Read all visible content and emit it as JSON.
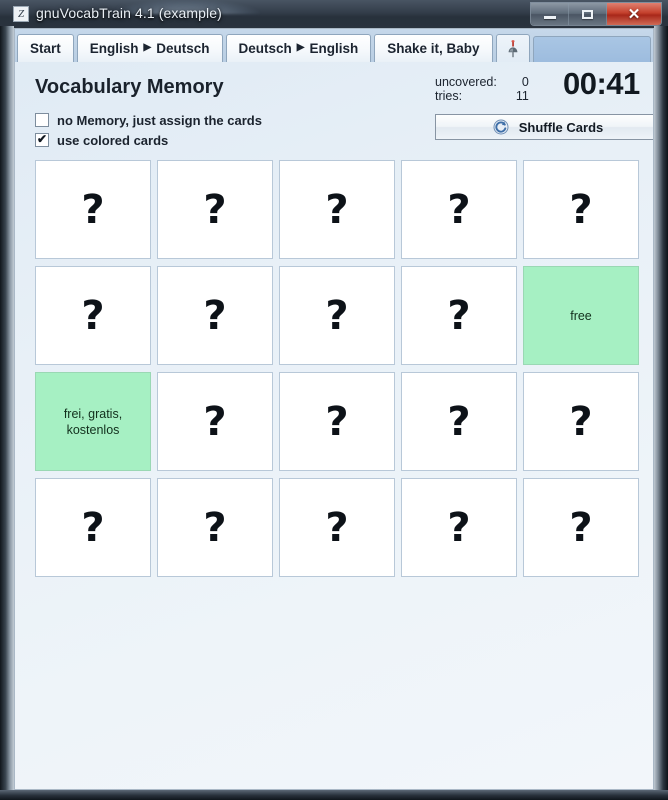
{
  "window": {
    "title": "gnuVocabTrain 4.1 (example)",
    "app_icon": "app-icon",
    "controls": {
      "minimize": "minimize-button",
      "maximize": "maximize-button",
      "close_glyph": "✕"
    }
  },
  "tabs": [
    {
      "label": "Start",
      "type": "text",
      "active": false
    },
    {
      "label": "English",
      "label2": "Deutsch",
      "arrow": "▶",
      "type": "arrow",
      "active": false
    },
    {
      "label": "Deutsch",
      "label2": "English",
      "arrow": "▶",
      "type": "arrow",
      "active": false
    },
    {
      "label": "Shake it, Baby",
      "type": "text",
      "active": false
    },
    {
      "label": "",
      "type": "pin",
      "icon": "pushpin-icon",
      "active": true
    }
  ],
  "header": {
    "page_title": "Vocabulary Memory",
    "checkboxes": [
      {
        "label": "no Memory, just assign the cards",
        "checked": false,
        "tick": ""
      },
      {
        "label": "use colored cards",
        "checked": true,
        "tick": "✔"
      }
    ],
    "stats": {
      "uncovered_label": "uncovered:",
      "uncovered_value": "0",
      "tries_label": "tries:",
      "tries_value": "11"
    },
    "timer": "00:41",
    "shuffle_button": {
      "label": "Shuffle Cards",
      "icon": "refresh-icon"
    }
  },
  "colors": {
    "revealed_card": "#a6f0c3",
    "card_border": "#b8c8d8",
    "panel_bg": "#e8f0f7",
    "tabbar_bg": "#bdd1e5",
    "close_button": "#c4402c"
  },
  "board": {
    "columns": 5,
    "rows": 4,
    "hidden_symbol": "?",
    "cards": [
      {
        "state": "hidden",
        "text": "?"
      },
      {
        "state": "hidden",
        "text": "?"
      },
      {
        "state": "hidden",
        "text": "?"
      },
      {
        "state": "hidden",
        "text": "?"
      },
      {
        "state": "hidden",
        "text": "?"
      },
      {
        "state": "hidden",
        "text": "?"
      },
      {
        "state": "hidden",
        "text": "?"
      },
      {
        "state": "hidden",
        "text": "?"
      },
      {
        "state": "hidden",
        "text": "?"
      },
      {
        "state": "revealed",
        "text": "free"
      },
      {
        "state": "revealed",
        "text": "frei, gratis, kostenlos"
      },
      {
        "state": "hidden",
        "text": "?"
      },
      {
        "state": "hidden",
        "text": "?"
      },
      {
        "state": "hidden",
        "text": "?"
      },
      {
        "state": "hidden",
        "text": "?"
      },
      {
        "state": "hidden",
        "text": "?"
      },
      {
        "state": "hidden",
        "text": "?"
      },
      {
        "state": "hidden",
        "text": "?"
      },
      {
        "state": "hidden",
        "text": "?"
      },
      {
        "state": "hidden",
        "text": "?"
      }
    ]
  }
}
